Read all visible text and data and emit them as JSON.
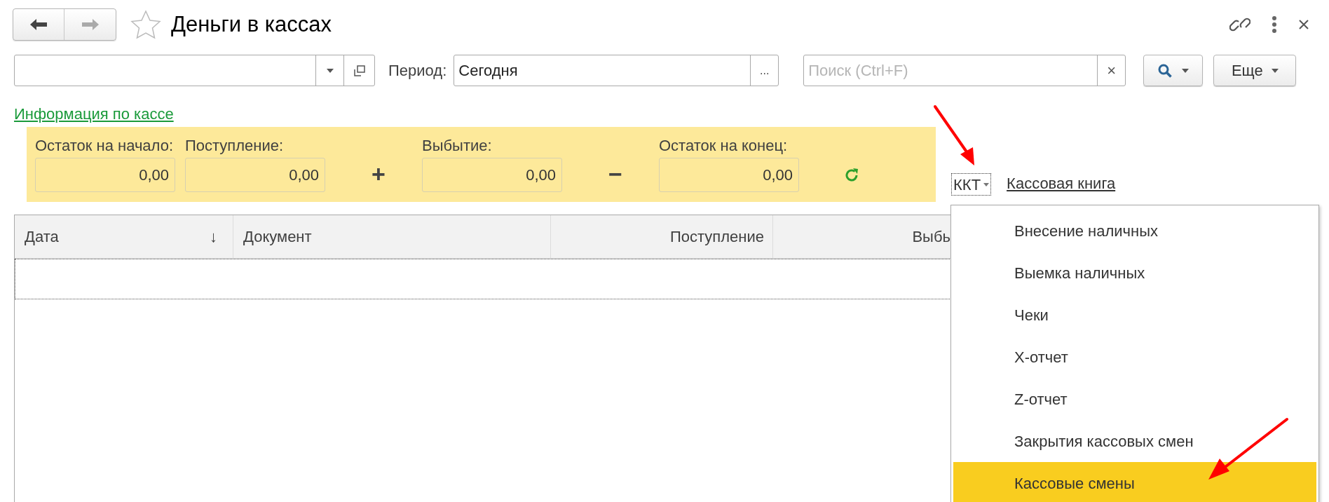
{
  "window": {
    "title": "Деньги в кассах",
    "favorite": false
  },
  "filter": {
    "period_label": "Период:",
    "period_value": "Сегодня",
    "period_button": "...",
    "search_placeholder": "Поиск (Ctrl+F)",
    "search_clear": "×",
    "more_button": "Еще"
  },
  "info_link": "Информация по кассе",
  "summary": [
    {
      "kind": "field",
      "label": "Остаток на начало:",
      "value": "0,00"
    },
    {
      "kind": "field",
      "label": "Поступление:",
      "value": "0,00"
    },
    {
      "kind": "operator",
      "symbol": "+"
    },
    {
      "kind": "field",
      "label": "Выбытие:",
      "value": "0,00"
    },
    {
      "kind": "operator",
      "symbol": "−"
    },
    {
      "kind": "field",
      "label": "Остаток на конец:",
      "value": "0,00"
    }
  ],
  "kkt_button": "ККТ",
  "cash_book_link": "Кассовая книга",
  "table": {
    "columns": [
      {
        "label": "Дата",
        "kind": "text",
        "sort": "↓"
      },
      {
        "label": "Документ",
        "kind": "text"
      },
      {
        "label": "Поступление",
        "kind": "number"
      },
      {
        "label": "Выбь",
        "kind": "number"
      }
    ]
  },
  "menu": {
    "items": [
      {
        "label": "Внесение наличных",
        "selected": false
      },
      {
        "label": "Выемка наличных",
        "selected": false
      },
      {
        "label": "Чеки",
        "selected": false
      },
      {
        "label": "X-отчет",
        "selected": false
      },
      {
        "label": "Z-отчет",
        "selected": false
      },
      {
        "label": "Закрытия кассовых смен",
        "selected": false
      },
      {
        "label": "Кассовые смены",
        "selected": true
      }
    ]
  }
}
